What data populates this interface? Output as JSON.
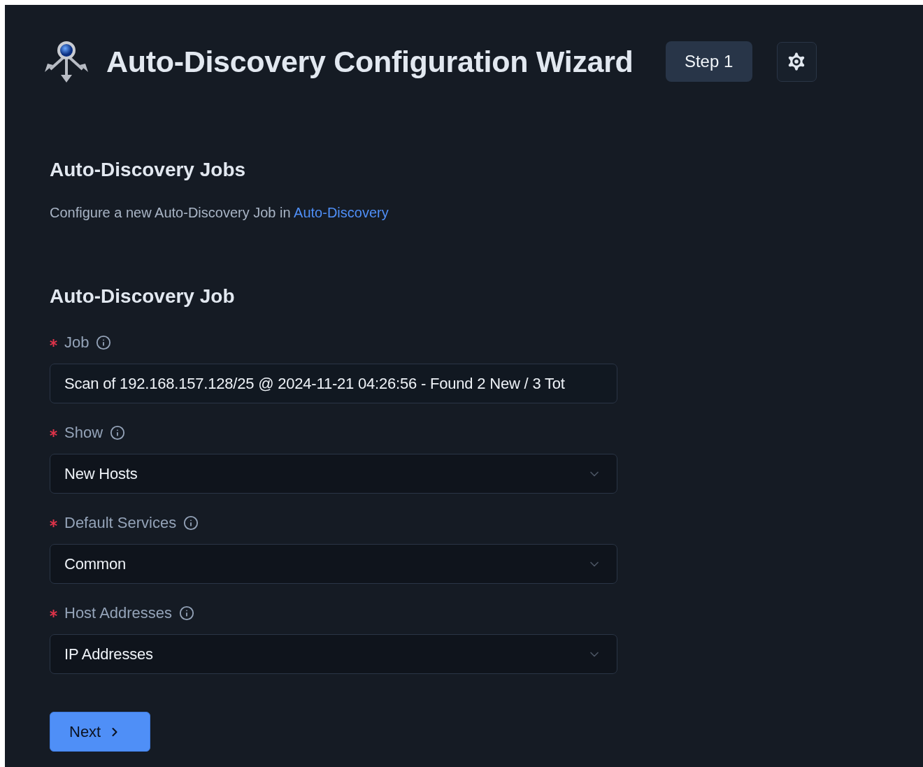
{
  "header": {
    "title": "Auto-Discovery Configuration Wizard",
    "step_badge": "Step 1"
  },
  "intro": {
    "heading": "Auto-Discovery Jobs",
    "description": "Configure a new Auto-Discovery Job in ",
    "link": "Auto-Discovery"
  },
  "form": {
    "heading": "Auto-Discovery Job",
    "fields": [
      {
        "label": "Job",
        "required": true,
        "kind": "text",
        "value": "Scan of 192.168.157.128/25 @ 2024-11-21 04:26:56 - Found 2 New / 3 Tot"
      },
      {
        "label": "Show",
        "required": true,
        "kind": "select",
        "value": "New Hosts"
      },
      {
        "label": "Default Services",
        "required": true,
        "kind": "select",
        "value": "Common"
      },
      {
        "label": "Host Addresses",
        "required": true,
        "kind": "select",
        "value": "IP Addresses"
      }
    ],
    "submit": "Next"
  }
}
